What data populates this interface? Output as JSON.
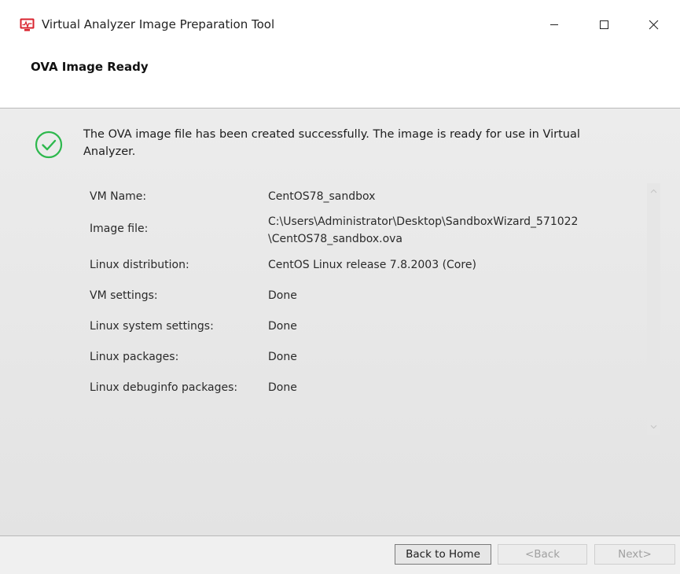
{
  "window": {
    "title": "Virtual Analyzer Image Preparation Tool",
    "icon": "app-monitor-icon",
    "controls": [
      "minimize-icon",
      "maximize-icon",
      "close-icon"
    ]
  },
  "header": {
    "title": "OVA Image Ready"
  },
  "content": {
    "status_icon": "check-circle-icon",
    "status_color": "#2db84d",
    "message": "The OVA image file has been created successfully. The image is ready for use in Virtual Analyzer.",
    "rows": [
      {
        "label": "VM Name:",
        "value": "CentOS78_sandbox"
      },
      {
        "label": "Image file:",
        "value_line1": "C:\\Users\\Administrator\\Desktop\\SandboxWizard_571022",
        "value_line2": "\\CentOS78_sandbox.ova"
      },
      {
        "label": "Linux distribution:",
        "value": "CentOS Linux release 7.8.2003 (Core)"
      },
      {
        "label": "VM settings:",
        "value": "Done"
      },
      {
        "label": "Linux system settings:",
        "value": "Done"
      },
      {
        "label": "Linux packages:",
        "value": "Done"
      },
      {
        "label": "Linux debuginfo packages:",
        "value": "Done"
      }
    ]
  },
  "footer": {
    "home_label": "Back to Home",
    "back_label": "<Back",
    "next_label": "Next>"
  }
}
